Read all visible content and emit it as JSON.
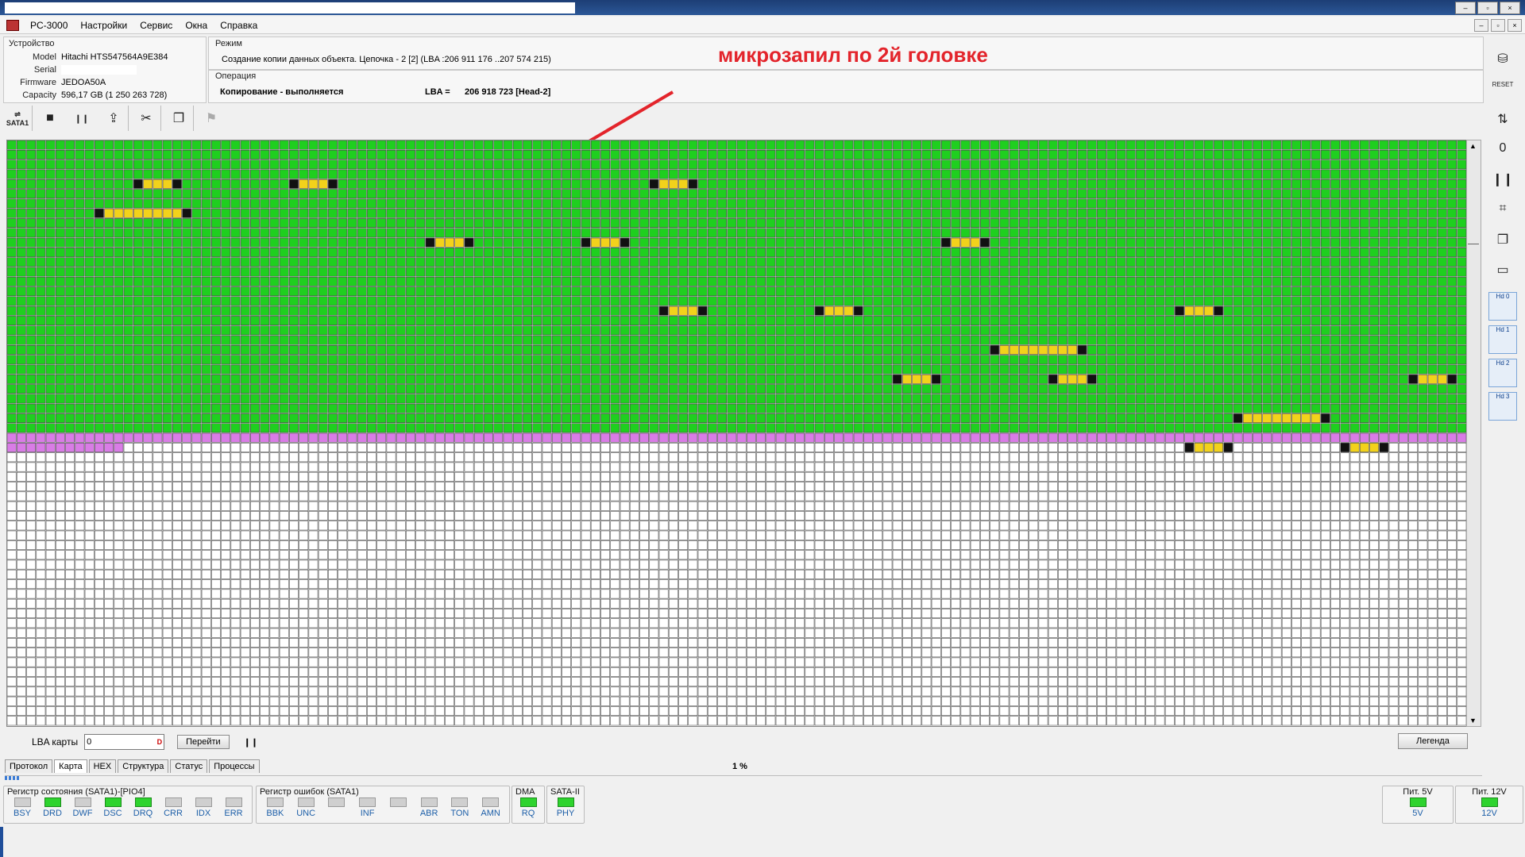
{
  "window": {
    "title": "PC-3000",
    "sys_buttons": [
      "–",
      "▫",
      "×"
    ],
    "mdi_buttons": [
      "–",
      "▫",
      "×"
    ]
  },
  "menu": [
    "Настройки",
    "Сервис",
    "Окна",
    "Справка"
  ],
  "device": {
    "group_label": "Устройство",
    "fields": [
      {
        "key": "Model",
        "value": "Hitachi HTS547564A9E384"
      },
      {
        "key": "Serial",
        "value": ""
      },
      {
        "key": "Firmware",
        "value": "JEDOA50A"
      },
      {
        "key": "Capacity",
        "value": "596,17 GB (1 250 263 728)"
      }
    ]
  },
  "mode": {
    "group_label": "Режим",
    "text": "Создание копии данных объекта. Цепочка - 2 [2] (LBA :206 911 176 ..207 574 215)"
  },
  "operation": {
    "group_label": "Операция",
    "status": "Копирование - выполняется",
    "lba_label": "LBA =",
    "lba_value": "206 918 723  [Head-2]"
  },
  "annotation": "микрозапил по 2й головке",
  "toolbar": {
    "port_label": "SATA1",
    "buttons": [
      {
        "name": "stop-button",
        "icon": "■"
      },
      {
        "name": "pause-button",
        "icon": "❙❙"
      },
      {
        "name": "export-button",
        "icon": "⇪"
      },
      {
        "name": "tools-button",
        "icon": "✂"
      },
      {
        "name": "copy-button",
        "icon": "❐"
      },
      {
        "name": "run-button",
        "icon": "⚑"
      }
    ]
  },
  "map": {
    "colors": {
      "read": "#1fcf1f",
      "error_block": "#f2d21b",
      "error_edge": "#111111",
      "current": "#d97ce6",
      "empty": "#ffffff",
      "grid_line": "#4d4d4d"
    },
    "cols": 150,
    "rows": 60,
    "read_rows": 30,
    "bad_runs": [
      {
        "row": 4,
        "col": 13,
        "len": 5
      },
      {
        "row": 4,
        "col": 29,
        "len": 5
      },
      {
        "row": 4,
        "col": 66,
        "len": 5
      },
      {
        "row": 7,
        "col": 9,
        "len": 10
      },
      {
        "row": 10,
        "col": 43,
        "len": 5
      },
      {
        "row": 10,
        "col": 59,
        "len": 5
      },
      {
        "row": 10,
        "col": 96,
        "len": 5
      },
      {
        "row": 17,
        "col": 67,
        "len": 5
      },
      {
        "row": 17,
        "col": 83,
        "len": 5
      },
      {
        "row": 17,
        "col": 120,
        "len": 5
      },
      {
        "row": 21,
        "col": 101,
        "len": 10
      },
      {
        "row": 24,
        "col": 91,
        "len": 5
      },
      {
        "row": 24,
        "col": 107,
        "len": 5
      },
      {
        "row": 24,
        "col": 144,
        "len": 5
      },
      {
        "row": 28,
        "col": 126,
        "len": 10
      },
      {
        "row": 31,
        "col": 121,
        "len": 5
      },
      {
        "row": 31,
        "col": 137,
        "len": 5
      }
    ],
    "current_row": 32,
    "current_start_col": 145,
    "current_next_row_len": 12
  },
  "lba_map": {
    "label": "LBA карты",
    "value": "0",
    "go_button": "Перейти",
    "pause_icon": "❙❙",
    "legend_button": "Легенда"
  },
  "tabs": [
    {
      "label": "Протокол",
      "active": false
    },
    {
      "label": "Карта",
      "active": true
    },
    {
      "label": "HEX",
      "active": false
    },
    {
      "label": "Структура",
      "active": false
    },
    {
      "label": "Статус",
      "active": false
    },
    {
      "label": "Процессы",
      "active": false
    }
  ],
  "progress_text": "1 %",
  "progress_value": 1,
  "status_register": {
    "title": "Регистр состояния (SATA1)-[PIO4]",
    "leds": [
      {
        "label": "BSY",
        "on": false
      },
      {
        "label": "DRD",
        "on": true
      },
      {
        "label": "DWF",
        "on": false
      },
      {
        "label": "DSC",
        "on": true
      },
      {
        "label": "DRQ",
        "on": true
      },
      {
        "label": "CRR",
        "on": false
      },
      {
        "label": "IDX",
        "on": false
      },
      {
        "label": "ERR",
        "on": false
      }
    ]
  },
  "error_register": {
    "title": "Регистр ошибок  (SATA1)",
    "leds": [
      {
        "label": "BBK",
        "on": false
      },
      {
        "label": "UNC",
        "on": false
      },
      {
        "label": "",
        "on": false
      },
      {
        "label": "INF",
        "on": false
      },
      {
        "label": "",
        "on": false
      },
      {
        "label": "ABR",
        "on": false
      },
      {
        "label": "TON",
        "on": false
      },
      {
        "label": "AMN",
        "on": false
      }
    ]
  },
  "dma": {
    "title": "DMA",
    "led": {
      "label": "RQ",
      "on": true
    }
  },
  "sata": {
    "title": "SATA-II",
    "led": {
      "label": "PHY",
      "on": true
    }
  },
  "power5": {
    "title": "Пит. 5V",
    "led": {
      "label": "5V",
      "on": true
    }
  },
  "power12": {
    "title": "Пит. 12V",
    "led": {
      "label": "12V",
      "on": true
    }
  },
  "right_tools": [
    {
      "name": "power-tool",
      "icon": "⛁"
    },
    {
      "name": "reset-tool",
      "icon": "RESET"
    },
    {
      "name": "connect-tool",
      "icon": "⇅"
    },
    {
      "name": "zero-tool",
      "icon": "0"
    },
    {
      "name": "pause-tool",
      "icon": "❙❙"
    },
    {
      "name": "link-tool",
      "icon": "⌗"
    },
    {
      "name": "copy-tool",
      "icon": "❐"
    },
    {
      "name": "drive-tool",
      "icon": "▭"
    }
  ],
  "heads": [
    "Hd 0",
    "Hd 1",
    "Hd 2",
    "Hd 3"
  ]
}
